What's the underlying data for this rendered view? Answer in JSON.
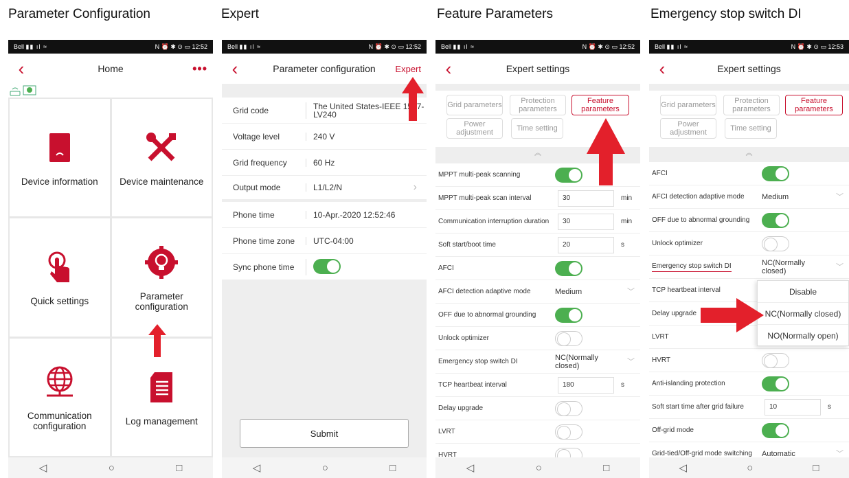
{
  "captions": [
    "Parameter Configuration",
    "Expert",
    "Feature Parameters",
    "Emergency stop switch DI"
  ],
  "statusbar": {
    "carrier": "Bell",
    "time1": "12:52",
    "time4": "12:53"
  },
  "nav": {
    "back": "◁",
    "home": "○",
    "recent": "□"
  },
  "screen1": {
    "title": "Home",
    "tiles": [
      "Device information",
      "Device maintenance",
      "Quick settings",
      "Parameter configuration",
      "Communication configuration",
      "Log management"
    ]
  },
  "screen2": {
    "title": "Parameter configuration",
    "action": "Expert",
    "rows": [
      {
        "label": "Grid code",
        "value": "The United States-IEEE 1547-LV240"
      },
      {
        "label": "Voltage level",
        "value": "240  V"
      },
      {
        "label": "Grid frequency",
        "value": "60  Hz"
      },
      {
        "label": "Output mode",
        "value": "L1/L2/N"
      },
      {
        "label": "Phone time",
        "value": "10-Apr.-2020 12:52:46"
      },
      {
        "label": "Phone time zone",
        "value": "UTC-04:00"
      },
      {
        "label": "Sync phone time",
        "value": ""
      }
    ],
    "submit": "Submit"
  },
  "expert": {
    "title": "Expert settings",
    "tabs": [
      "Grid parameters",
      "Protection parameters",
      "Feature parameters",
      "Power adjustment",
      "Time setting"
    ]
  },
  "screen3": {
    "rows": [
      {
        "label": "MPPT multi-peak scanning"
      },
      {
        "label": "MPPT multi-peak scan interval",
        "value": "30",
        "unit": "min"
      },
      {
        "label": "Communication interruption duration",
        "value": "30",
        "unit": "min"
      },
      {
        "label": "Soft start/boot time",
        "value": "20",
        "unit": "s"
      },
      {
        "label": "AFCI"
      },
      {
        "label": "AFCI detection adaptive mode",
        "value": "Medium"
      },
      {
        "label": "OFF due to abnormal grounding"
      },
      {
        "label": "Unlock optimizer"
      },
      {
        "label": "Emergency stop switch DI",
        "value": "NC(Normally closed)"
      },
      {
        "label": "TCP heartbeat interval",
        "value": "180",
        "unit": "s"
      },
      {
        "label": "Delay upgrade"
      },
      {
        "label": "LVRT"
      },
      {
        "label": "HVRT"
      }
    ]
  },
  "screen4": {
    "rows": [
      {
        "label": "AFCI"
      },
      {
        "label": "AFCI detection adaptive mode",
        "value": "Medium"
      },
      {
        "label": "OFF due to abnormal grounding"
      },
      {
        "label": "Unlock optimizer"
      },
      {
        "label": "Emergency stop switch DI",
        "value": "NC(Normally closed)"
      },
      {
        "label": "TCP heartbeat interval"
      },
      {
        "label": "Delay upgrade"
      },
      {
        "label": "LVRT"
      },
      {
        "label": "HVRT"
      },
      {
        "label": "Anti-islanding protection"
      },
      {
        "label": "Soft start time after grid failure",
        "value": "10",
        "unit": "s"
      },
      {
        "label": "Off-grid mode"
      },
      {
        "label": "Grid-tied/Off-grid mode switching",
        "value": "Automatic"
      }
    ],
    "dropdown": [
      "Disable",
      "NC(Normally closed)",
      "NO(Normally open)"
    ]
  },
  "colors": {
    "accent": "#c8102e",
    "toggle_on": "#4caf50",
    "arrow": "#e3202b"
  }
}
